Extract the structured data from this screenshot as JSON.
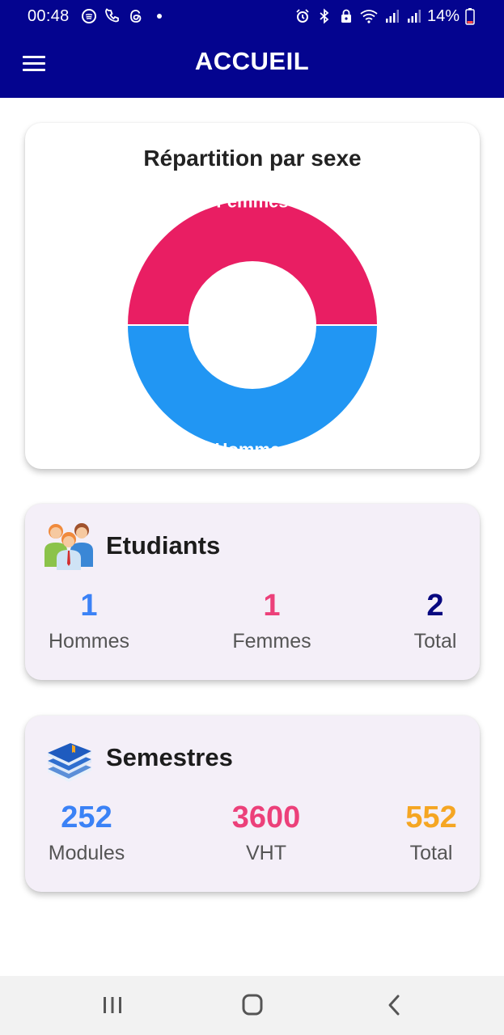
{
  "status_bar": {
    "time": "00:48",
    "battery": "14%"
  },
  "app_bar": {
    "title": "ACCUEIL"
  },
  "chart_card": {
    "title": "Répartition par sexe",
    "chart_data": {
      "type": "pie",
      "title": "Répartition par sexe",
      "categories": [
        "Femmes",
        "Hommes"
      ],
      "values": [
        1,
        1
      ],
      "colors": [
        "#e91e63",
        "#2196f3"
      ],
      "donut": true
    }
  },
  "etudiants": {
    "title": "Etudiants",
    "stats": [
      {
        "value": "1",
        "label": "Hommes",
        "color": "#3b82f6"
      },
      {
        "value": "1",
        "label": "Femmes",
        "color": "#ec407a"
      },
      {
        "value": "2",
        "label": "Total",
        "color": "#080880"
      }
    ]
  },
  "semestres": {
    "title": "Semestres",
    "stats": [
      {
        "value": "252",
        "label": "Modules",
        "color": "#3b82f6"
      },
      {
        "value": "3600",
        "label": "VHT",
        "color": "#ec407a"
      },
      {
        "value": "552",
        "label": "Total",
        "color": "#f5a623"
      }
    ]
  },
  "nav": {
    "icons": [
      "recent-apps-icon",
      "home-icon",
      "back-icon"
    ]
  }
}
